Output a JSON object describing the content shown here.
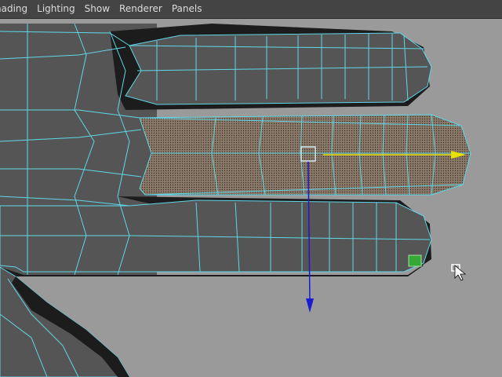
{
  "menubar": {
    "items": [
      {
        "label": "hading"
      },
      {
        "label": "Lighting"
      },
      {
        "label": "Show"
      },
      {
        "label": "Renderer"
      },
      {
        "label": "Panels"
      }
    ]
  },
  "viewport": {
    "background_color": "#9a9a9a",
    "mesh_face_color": "#555555",
    "wire_color": "#5fd7e8",
    "selected_face_color": "#8c7b6a",
    "gizmo": {
      "x_axis_color": "#e8e000",
      "y_axis_color": "#1a1ad0",
      "center_handle_color": "#cfe9ef"
    },
    "selected_vertex_color": "#36a836"
  }
}
